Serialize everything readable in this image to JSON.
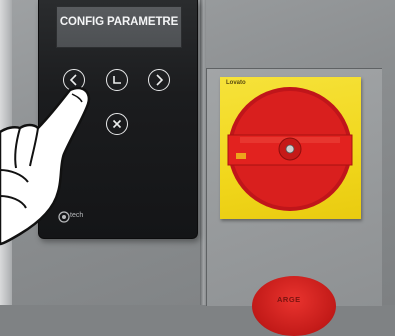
{
  "hmi": {
    "screen_title": "CONFIG PARAMETRE",
    "buttons": [
      {
        "name": "prev-button",
        "icon": "chevron-left-icon"
      },
      {
        "name": "enter-button",
        "icon": "return-icon"
      },
      {
        "name": "next-button",
        "icon": "chevron-right-icon"
      },
      {
        "name": "cancel-button",
        "icon": "close-icon"
      }
    ],
    "brand": "tech"
  },
  "switch": {
    "brand": "Lovato"
  },
  "estop": {
    "label": "ARGE"
  },
  "colors": {
    "panel": "#1b1c1e",
    "screen": "#4f5255",
    "plate": "#f1d71c",
    "knob": "#d81f1d",
    "estop": "#c21a18"
  }
}
